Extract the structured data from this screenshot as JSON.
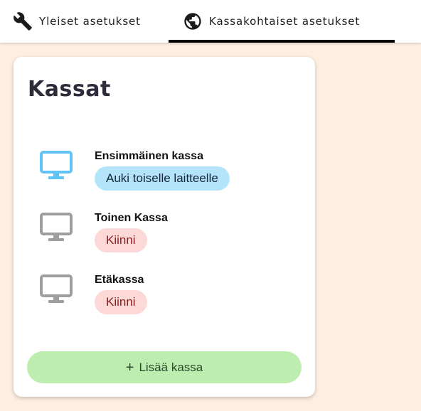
{
  "tabs": [
    {
      "label": "Yleiset asetukset",
      "icon": "wrench-icon",
      "active": false
    },
    {
      "label": "Kassakohtaiset asetukset",
      "icon": "globe-icon",
      "active": true
    }
  ],
  "card": {
    "title": "Kassat",
    "registers": [
      {
        "name": "Ensimmäinen kassa",
        "status": "Auki toiselle laitteelle",
        "state": "open",
        "icon": "monitor-icon"
      },
      {
        "name": "Toinen Kassa",
        "status": "Kiinni",
        "state": "closed",
        "icon": "monitor-icon"
      },
      {
        "name": "Etäkassa",
        "status": "Kiinni",
        "state": "closed",
        "icon": "monitor-icon"
      }
    ],
    "add_button": {
      "icon": "+",
      "label": "Lisää kassa"
    }
  },
  "colors": {
    "background": "#fdeee1",
    "monitor_open": "#5fc4f3",
    "monitor_closed": "#9e9e9e",
    "badge_open": "#b4e4fa",
    "badge_closed": "#fcd8d6",
    "add_button": "#bdeeb0"
  }
}
